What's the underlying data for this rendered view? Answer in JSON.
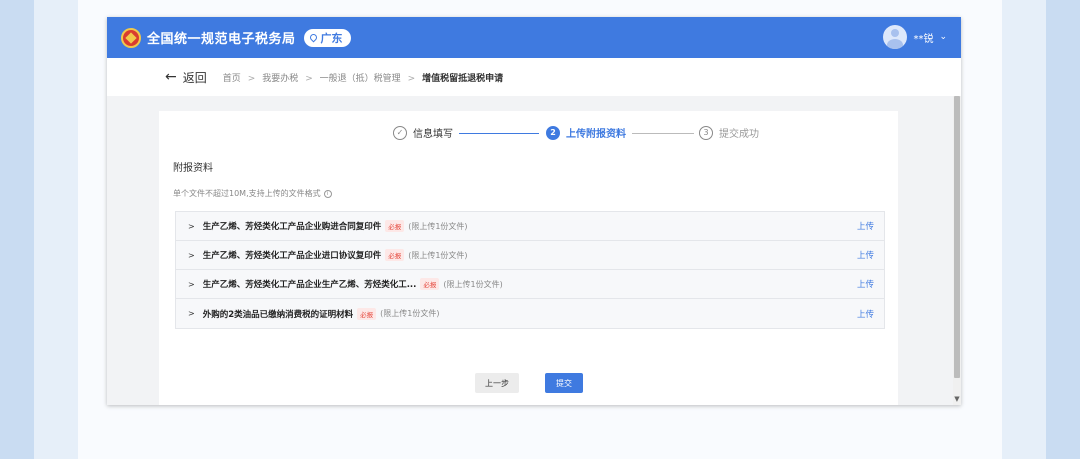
{
  "header": {
    "site_title": "全国统一规范电子税务局",
    "region": "广东",
    "user_name": "**锐"
  },
  "breadcrumb": {
    "back_label": "返回",
    "items": [
      "首页",
      "我要办税",
      "一般退（抵）税管理",
      "增值税留抵退税申请"
    ]
  },
  "steps": [
    {
      "num": "✓",
      "label": "信息填写",
      "state": "done"
    },
    {
      "num": "2",
      "label": "上传附报资料",
      "state": "active"
    },
    {
      "num": "3",
      "label": "提交成功",
      "state": "pending"
    }
  ],
  "section": {
    "title": "附报资料",
    "hint": "单个文件不超过10M,支持上传的文件格式"
  },
  "files": [
    {
      "name": "生产乙烯、芳烃类化工产品企业购进合同复印件",
      "required": "必报",
      "limit": "(限上传1份文件)",
      "action": "上传"
    },
    {
      "name": "生产乙烯、芳烃类化工产品企业进口协议复印件",
      "required": "必报",
      "limit": "(限上传1份文件)",
      "action": "上传"
    },
    {
      "name": "生产乙烯、芳烃类化工产品企业生产乙烯、芳烃类化工...",
      "required": "必报",
      "limit": "(限上传1份文件)",
      "action": "上传"
    },
    {
      "name": "外购的2类油品已缴纳消费税的证明材料",
      "required": "必报",
      "limit": "(限上传1份文件)",
      "action": "上传"
    }
  ],
  "buttons": {
    "prev": "上一步",
    "submit": "提交"
  },
  "colors": {
    "primary": "#3f7ae0",
    "required_tag": "#e5483d"
  }
}
